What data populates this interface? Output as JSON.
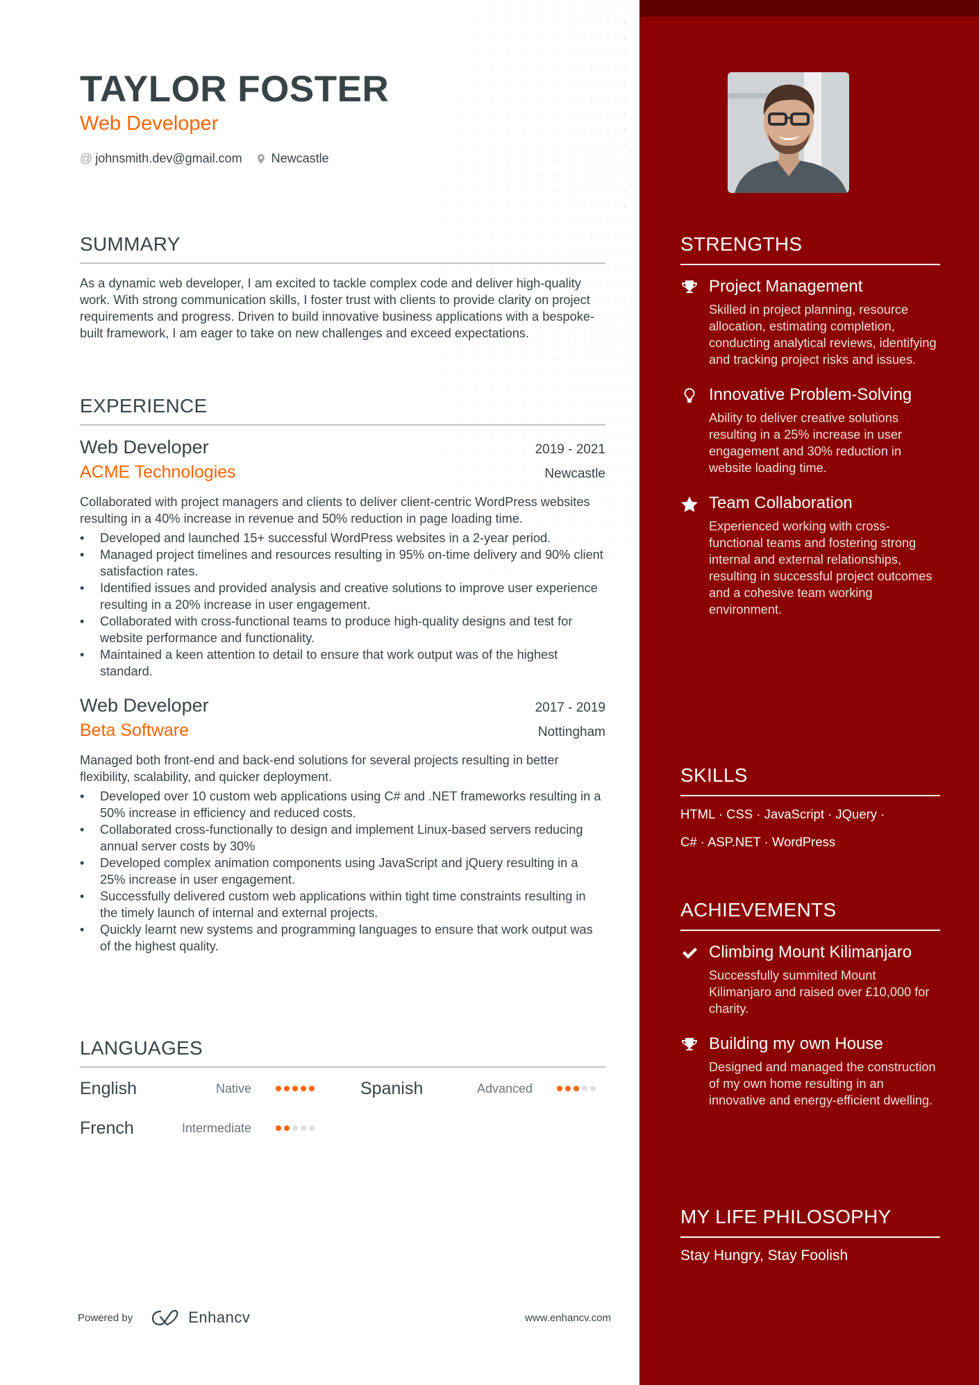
{
  "header": {
    "name": "TAYLOR FOSTER",
    "title": "Web Developer",
    "email_icon": "at-icon",
    "email": "johnsmith.dev@gmail.com",
    "location_icon": "map-pin-icon",
    "location": "Newcastle"
  },
  "summary": {
    "heading": "SUMMARY",
    "text": "As a dynamic web developer, I am excited to tackle complex code and deliver high-quality work. With strong communication skills, I foster trust with clients to provide clarity on project requirements and progress. Driven to build innovative business applications with a bespoke-built framework, I am eager to take on new challenges and exceed expectations."
  },
  "experience": {
    "heading": "EXPERIENCE",
    "jobs": [
      {
        "role": "Web Developer",
        "dates": "2019 - 2021",
        "company": "ACME Technologies",
        "location": "Newcastle",
        "description": "Collaborated with project managers and clients to deliver client-centric WordPress websites resulting in a 40% increase in revenue and 50% reduction in page loading time.",
        "bullets": [
          "Developed and launched 15+ successful WordPress websites in a 2-year period.",
          "Managed project timelines and resources resulting in 95% on-time delivery and 90% client satisfaction rates.",
          "Identified issues and provided analysis and creative solutions to improve user experience resulting in a 20% increase in user engagement.",
          "Collaborated with cross-functional teams to produce high-quality designs and test for website performance and functionality.",
          "Maintained a keen attention to detail to ensure that work output was of the highest standard."
        ]
      },
      {
        "role": "Web Developer",
        "dates": "2017 - 2019",
        "company": "Beta Software",
        "location": "Nottingham",
        "description": "Managed both front-end and back-end solutions for several projects resulting in better flexibility, scalability, and quicker deployment.",
        "bullets": [
          "Developed over 10 custom web applications using C# and .NET frameworks resulting in a 50% increase in efficiency and reduced costs.",
          "Collaborated cross-functionally to design and implement Linux-based servers reducing annual server costs by 30%",
          "Developed complex animation components using JavaScript and jQuery resulting in a 25% increase in user engagement.",
          "Successfully delivered custom web applications within tight time constraints resulting in the timely launch of internal and external projects.",
          "Quickly learnt new systems and programming languages to ensure that work output was of the highest quality."
        ]
      }
    ]
  },
  "languages": {
    "heading": "LANGUAGES",
    "items": [
      {
        "name": "English",
        "level": "Native",
        "rating": 5,
        "max": 5
      },
      {
        "name": "Spanish",
        "level": "Advanced",
        "rating": 3,
        "max": 5
      },
      {
        "name": "French",
        "level": "Intermediate",
        "rating": 2,
        "max": 5
      }
    ]
  },
  "footer": {
    "powered_by": "Powered by",
    "brand": "Enhancv",
    "website": "www.enhancv.com"
  },
  "sidebar": {
    "photo_alt": "Profile photo",
    "strengths": {
      "heading": "STRENGTHS",
      "items": [
        {
          "icon": "trophy-icon",
          "title": "Project Management",
          "description": "Skilled in project planning, resource allocation, estimating completion, conducting analytical reviews, identifying and tracking project risks and issues."
        },
        {
          "icon": "lightbulb-icon",
          "title": "Innovative Problem-Solving",
          "description": "Ability to deliver creative solutions resulting in a 25% increase in user engagement and 30% reduction in website loading time."
        },
        {
          "icon": "star-icon",
          "title": "Team Collaboration",
          "description": "Experienced working with cross-functional teams and fostering strong internal and external relationships, resulting in successful project outcomes and a cohesive team working environment."
        }
      ]
    },
    "skills": {
      "heading": "SKILLS",
      "items": [
        "HTML",
        "CSS",
        "JavaScript",
        "JQuery",
        "C#",
        "ASP.NET",
        "WordPress"
      ],
      "line1": "HTML · CSS · JavaScript · JQuery ·",
      "line2": "C# · ASP.NET · WordPress"
    },
    "achievements": {
      "heading": "ACHIEVEMENTS",
      "items": [
        {
          "icon": "checkmark-icon",
          "title": "Climbing Mount Kilimanjaro",
          "description": "Successfully summited Mount Kilimanjaro and raised over £10,000 for charity."
        },
        {
          "icon": "trophy-icon",
          "title": "Building my own House",
          "description": "Designed and managed the construction of my own home resulting in an innovative and energy-efficient dwelling."
        }
      ]
    },
    "philosophy": {
      "heading": "MY LIFE PHILOSOPHY",
      "text": "Stay Hungry, Stay Foolish"
    }
  },
  "colors": {
    "accent": "#ff6600",
    "sidebar_bg": "#8b0000",
    "sidebar_top": "#5e0000",
    "text": "#384347"
  }
}
